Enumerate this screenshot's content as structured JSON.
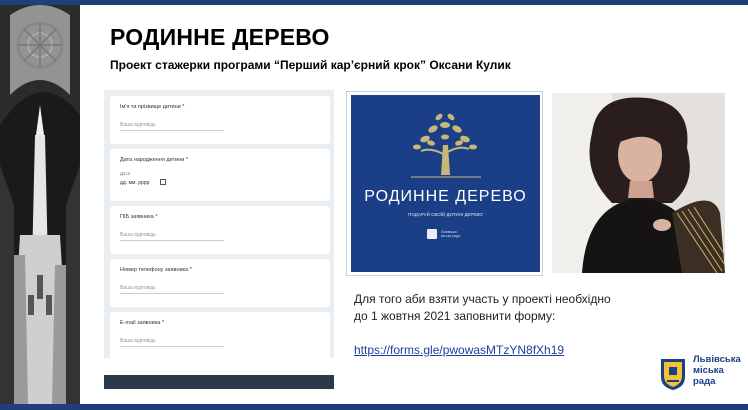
{
  "slide": {
    "title": "РОДИННЕ ДЕРЕВО",
    "subtitle": "Проект стажерки програми “Перший кар’єрний крок” Оксани Кулик",
    "info_line1": "Для того аби взяти участь у проекті необхідно",
    "info_line2": "до 1 жовтня 2021 заповнити форму:",
    "link": "https://forms.gle/pwowasMTzYN8fXh19"
  },
  "form": {
    "fields": [
      {
        "label": "Ім'я та прізвище дитини *",
        "placeholder": "Ваша відповідь"
      },
      {
        "label": "Дата народження дитини *",
        "date_label": "Дата",
        "date_value": "дд. мм. рррр"
      },
      {
        "label": "ПІБ заявника *",
        "placeholder": "Ваша відповідь"
      },
      {
        "label": "Номер телефону заявника *",
        "placeholder": "Ваша відповідь"
      },
      {
        "label": "E-mail заявника *",
        "placeholder": "Ваша відповідь"
      }
    ]
  },
  "logo": {
    "title": "РОДИННЕ ДЕРЕВО",
    "tagline": "ПОДАРУЙ СВОЇЙ ДИТИНІ ДЕРЕВО",
    "small_text": "Львівська міська рада"
  },
  "footer": {
    "city_line1": "Львівська",
    "city_line2": "міська",
    "city_line3": "рада"
  },
  "colors": {
    "brand_blue": "#1a3f87",
    "bar_blue": "#1f3f7a",
    "link_blue": "#1a3fa0",
    "logo_gold": "#c9b77a"
  },
  "icons": [
    "cathedral-photo",
    "tree-logo",
    "calendar-icon",
    "portrait-photo",
    "coat-of-arms-icon"
  ]
}
